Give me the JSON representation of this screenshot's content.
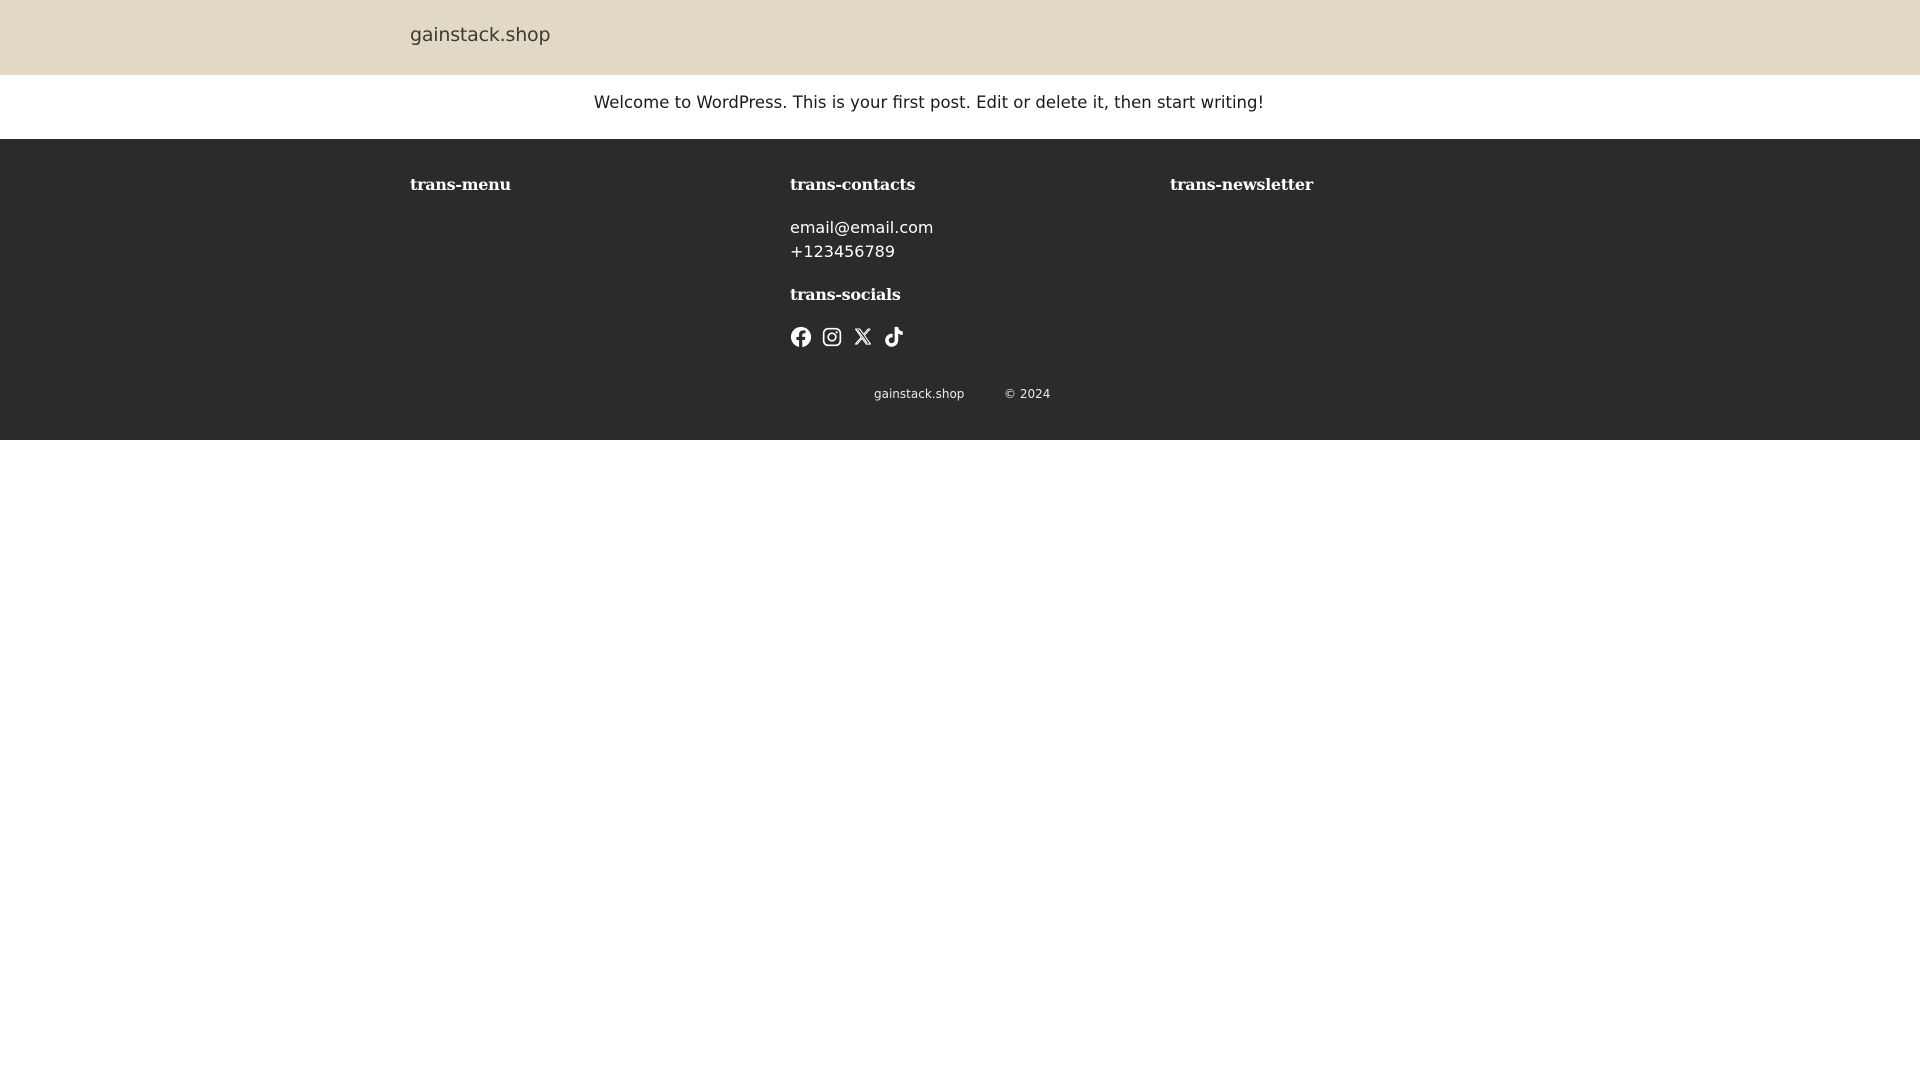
{
  "header": {
    "site_title": "gainstack.shop",
    "background_color": "#e2d8c6"
  },
  "post": {
    "excerpt": "Welcome to WordPress. This is your first post. Edit or delete it, then start writing!"
  },
  "footer": {
    "background_color": "#2c2b29",
    "menu_heading": "trans-menu",
    "contacts_heading": "trans-contacts",
    "newsletter_heading": "trans-newsletter",
    "email": "email@email.com",
    "phone": "+123456789",
    "socials_heading": "trans-socials",
    "social_icons": [
      "facebook-icon",
      "instagram-icon",
      "x-icon",
      "tiktok-icon"
    ],
    "bottom_site": "gainstack.shop",
    "copyright": "© 2024"
  }
}
